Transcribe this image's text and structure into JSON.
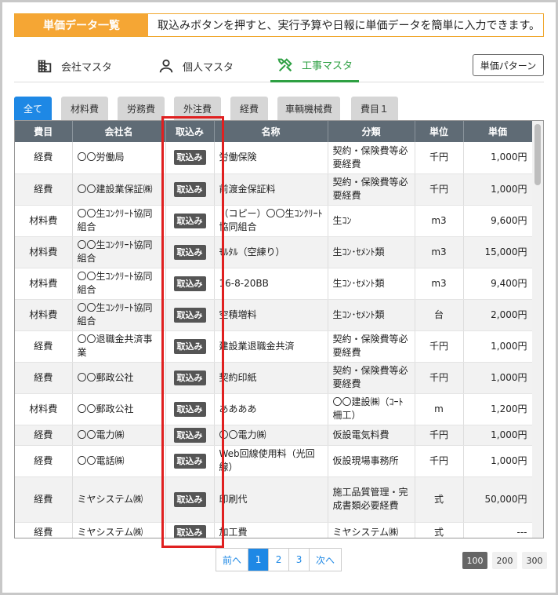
{
  "banner": {
    "tag": "単価データ一覧",
    "text": "取込みボタンを押すと、実行予算や日報に単価データを簡単に入力できます。"
  },
  "tabs": [
    {
      "label": "会社マスタ",
      "icon": "building-icon"
    },
    {
      "label": "個人マスタ",
      "icon": "person-icon"
    },
    {
      "label": "工事マスタ",
      "icon": "tools-icon",
      "active": true
    }
  ],
  "pattern_button": "単価パターン",
  "categories": [
    "全て",
    "材料費",
    "労務費",
    "外注費",
    "経費",
    "車輌機械費",
    "費目１"
  ],
  "table": {
    "headers": [
      "費目",
      "会社名",
      "取込み",
      "名称",
      "分類",
      "単位",
      "単価"
    ],
    "import_label": "取込み",
    "rows": [
      [
        "経費",
        "〇〇労働局",
        "取込み",
        "労働保険",
        "契約・保険費等必要経費",
        "千円",
        "1,000円"
      ],
      [
        "経費",
        "〇〇建設業保証㈱",
        "取込み",
        "前渡金保証料",
        "契約・保険費等必要経費",
        "千円",
        "1,000円"
      ],
      [
        "材料費",
        "〇〇生ｺﾝｸﾘｰﾄ協同組合",
        "取込み",
        "（コピー）〇〇生ｺﾝｸﾘｰﾄ協同組合",
        "生ｺﾝ",
        "m3",
        "9,600円"
      ],
      [
        "材料費",
        "〇〇生ｺﾝｸﾘｰﾄ協同組合",
        "取込み",
        "ﾓﾙﾀﾙ（空練り）",
        "生ｺﾝ･ｾﾒﾝﾄ類",
        "m3",
        "15,000円"
      ],
      [
        "材料費",
        "〇〇生ｺﾝｸﾘｰﾄ協同組合",
        "取込み",
        "16-8-20BB",
        "生ｺﾝ･ｾﾒﾝﾄ類",
        "m3",
        "9,400円"
      ],
      [
        "材料費",
        "〇〇生ｺﾝｸﾘｰﾄ協同組合",
        "取込み",
        "空積増料",
        "生ｺﾝ･ｾﾒﾝﾄ類",
        "台",
        "2,000円"
      ],
      [
        "経費",
        "〇〇退職金共済事業",
        "取込み",
        "建設業退職金共済",
        "契約・保険費等必要経費",
        "千円",
        "1,000円"
      ],
      [
        "経費",
        "〇〇郵政公社",
        "取込み",
        "契約印紙",
        "契約・保険費等必要経費",
        "千円",
        "1,000円"
      ],
      [
        "材料費",
        "〇〇郵政公社",
        "取込み",
        "ああああ",
        "〇〇建設㈱（ｺｰﾄ柵工）",
        "m",
        "1,200円"
      ],
      [
        "経費",
        "〇〇電力㈱",
        "取込み",
        "〇〇電力㈱",
        "仮設電気料費",
        "千円",
        "1,000円"
      ],
      [
        "経費",
        "〇〇電話㈱",
        "取込み",
        "Web回線使用料（光回線）",
        "仮設現場事務所",
        "千円",
        "1,000円"
      ],
      [
        "経費",
        "ミヤシステム㈱",
        "取込み",
        "印刷代",
        "施工品質管理・完成書類必要経費",
        "式",
        "50,000円"
      ],
      [
        "経費",
        "ミヤシステム㈱",
        "取込み",
        "加工費",
        "ミヤシステム㈱",
        "式",
        "---"
      ]
    ]
  },
  "pagination": {
    "prev": "前へ",
    "pages": [
      "1",
      "2",
      "3"
    ],
    "next": "次へ",
    "current": "1"
  },
  "page_sizes": [
    "100",
    "200",
    "300"
  ],
  "colors": {
    "accent": "#f5a634",
    "active_tab": "#2ea043",
    "primary": "#1e88e5",
    "highlight": "#e02020"
  }
}
